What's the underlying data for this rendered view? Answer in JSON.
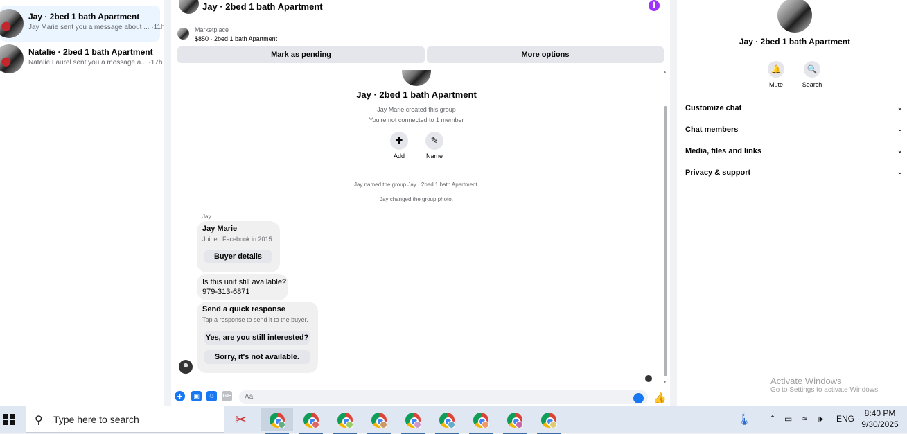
{
  "conversations": [
    {
      "name": "Jay · 2bed 1 bath Apartment",
      "preview": "Jay Marie sent you a message about ... ·11h"
    },
    {
      "name": "Natalie · 2bed 1 bath Apartment",
      "preview": "Natalie Laurel sent you a message a... ·17h"
    }
  ],
  "header": {
    "title": "Jay · 2bed 1 bath Apartment",
    "info_icon": "info-icon"
  },
  "marketplace": {
    "label": "Marketplace",
    "listing": "$850 · 2bed 1 bath Apartment",
    "mark_pending": "Mark as pending",
    "more_options": "More options"
  },
  "thread": {
    "group_title": "Jay · 2bed 1 bath Apartment",
    "created": "Jay Marie created this group",
    "connection": "You're not connected to 1 member",
    "add_label": "Add",
    "name_label": "Name",
    "system1": "Jay named the group Jay · 2bed 1 bath Apartment.",
    "system2": "Jay changed the group photo.",
    "sender": "Jay",
    "card_name": "Jay Marie",
    "card_sub": "Joined Facebook in 2015",
    "buyer_details": "Buyer details",
    "msg_line1": "Is this unit still available?",
    "msg_line2": "979-313-6871",
    "quick_title": "Send a quick response",
    "quick_sub": "Tap a response to send it to the buyer.",
    "quick_opt1": "Yes, are you still interested?",
    "quick_opt2": "Sorry, it's not available."
  },
  "composer": {
    "placeholder": "Aa",
    "gif": "GIF"
  },
  "right_panel": {
    "title": "Jay · 2bed 1 bath Apartment",
    "mute": "Mute",
    "search": "Search",
    "sections": [
      "Customize chat",
      "Chat members",
      "Media, files and links",
      "Privacy & support"
    ]
  },
  "watermark": {
    "line1": "Activate Windows",
    "line2": "Go to Settings to activate Windows."
  },
  "taskbar": {
    "search_placeholder": "Type here to search",
    "language": "ENG",
    "time": "8:40 PM",
    "date": "9/30/2025"
  },
  "colors": {
    "accent": "#1877f2",
    "info": "#a033ff",
    "bubble": "#f0f0f0"
  }
}
